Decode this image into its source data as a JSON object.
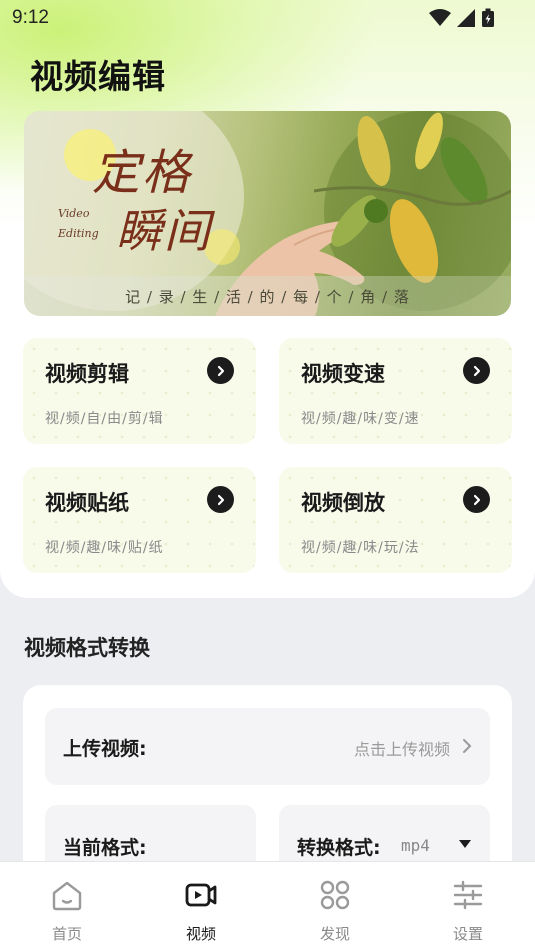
{
  "status_bar": {
    "time": "9:12"
  },
  "page": {
    "title": "视频编辑"
  },
  "banner": {
    "title_line1": "定格",
    "title_line2": "瞬间",
    "en_line1": "Video",
    "en_line2": "Editing",
    "tagline": "记 / 录 / 生 / 活 / 的 / 每 / 个 / 角 / 落"
  },
  "features": [
    {
      "title": "视频剪辑",
      "subtitle": "视/频/自/由/剪/辑"
    },
    {
      "title": "视频变速",
      "subtitle": "视/频/趣/味/变/速"
    },
    {
      "title": "视频贴纸",
      "subtitle": "视/频/趣/味/贴/纸"
    },
    {
      "title": "视频倒放",
      "subtitle": "视/频/趣/味/玩/法"
    }
  ],
  "format_section": {
    "title": "视频格式转换",
    "upload_label": "上传视频:",
    "upload_hint": "点击上传视频",
    "current_format_label": "当前格式:",
    "target_format_label": "转换格式:",
    "target_format_value": "mp4"
  },
  "bottom_nav": [
    {
      "label": "首页",
      "icon": "home-icon",
      "active": false
    },
    {
      "label": "视频",
      "icon": "video-icon",
      "active": true
    },
    {
      "label": "发现",
      "icon": "discover-icon",
      "active": false
    },
    {
      "label": "设置",
      "icon": "settings-icon",
      "active": false
    }
  ],
  "colors": {
    "accent_green": "#c8f06e",
    "card_bg": "#f8faea",
    "arrow_bg": "#1c1c1c"
  }
}
